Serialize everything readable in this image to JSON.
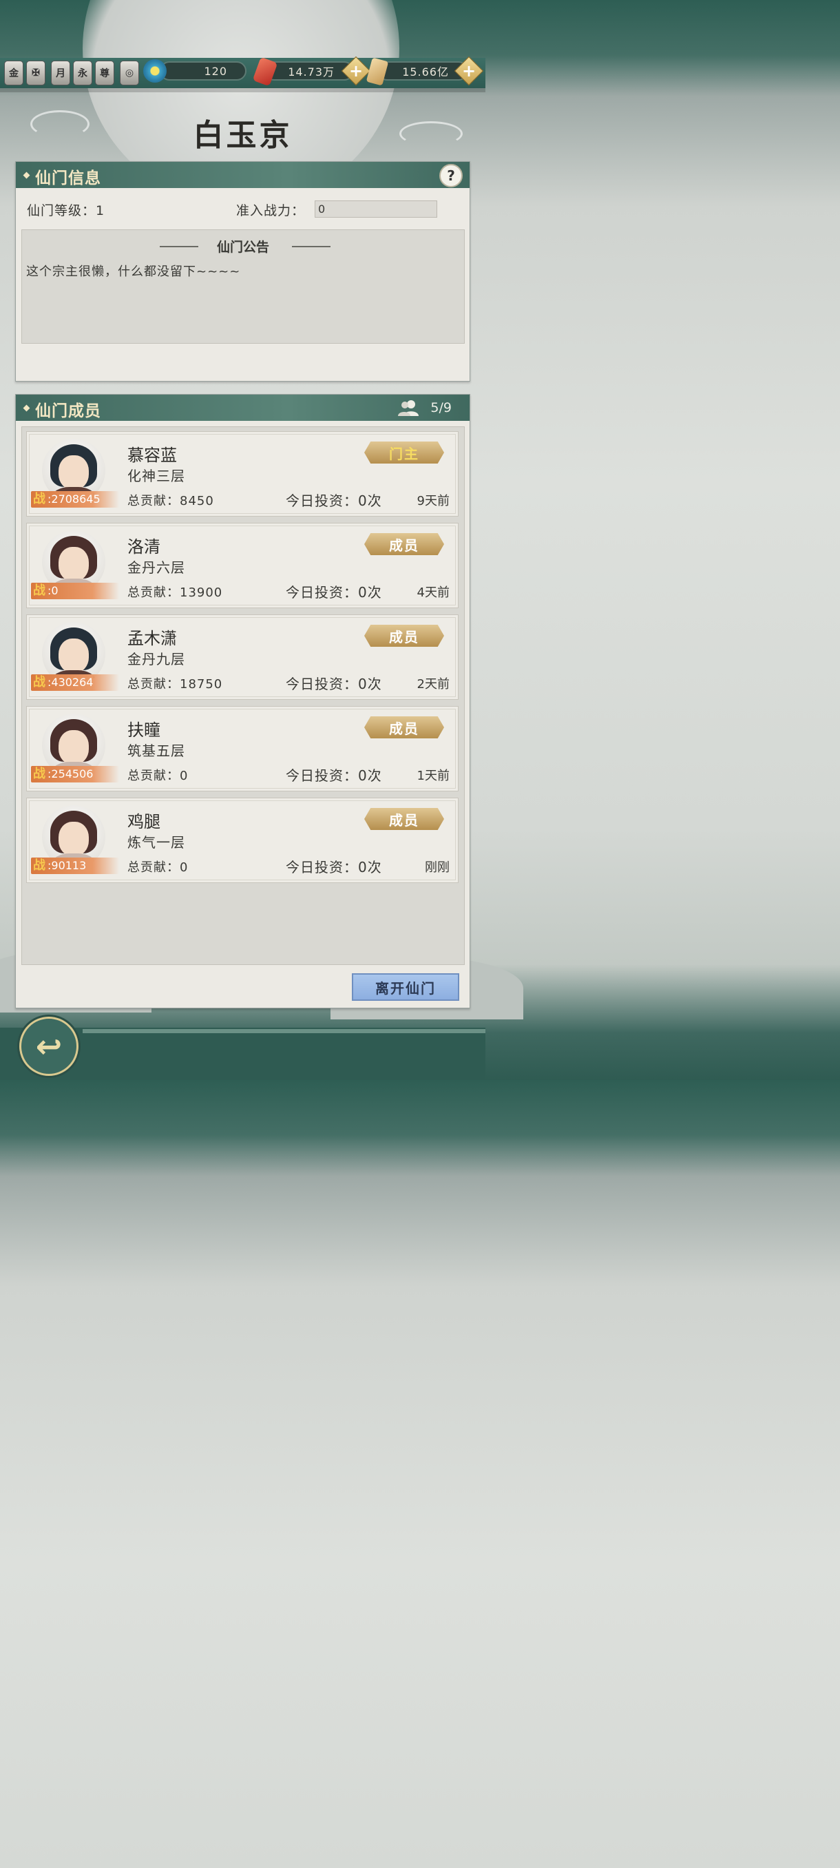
{
  "topbar": {
    "badges": [
      "金",
      "",
      "月",
      "永",
      "尊",
      ""
    ],
    "energy": "120",
    "currency1": "14.73万",
    "currency2": "15.66亿"
  },
  "title": "白玉京",
  "info_panel": {
    "header": "仙门信息",
    "help": "?",
    "level_label": "仙门等级：1",
    "power_label": "准入战力：",
    "power_value": "0",
    "notice_title": "仙门公告",
    "notice_text": "这个宗主很懒，什么都没留下~~~~"
  },
  "members_panel": {
    "header": "仙门成员",
    "count": "5/9",
    "members": [
      {
        "name": "慕容蓝",
        "rank": "化神三层",
        "power": ":2708645",
        "contribution": "总贡献：8450",
        "invest": "今日投资：0次",
        "time": "9天前",
        "role": "门主"
      },
      {
        "name": "洛清",
        "rank": "金丹六层",
        "power": ":0",
        "contribution": "总贡献：13900",
        "invest": "今日投资：0次",
        "time": "4天前",
        "role": "成员"
      },
      {
        "name": "孟木潇",
        "rank": "金丹九层",
        "power": ":430264",
        "contribution": "总贡献：18750",
        "invest": "今日投资：0次",
        "time": "2天前",
        "role": "成员"
      },
      {
        "name": "扶瞳",
        "rank": "筑基五层",
        "power": ":254506",
        "contribution": "总贡献：0",
        "invest": "今日投资：0次",
        "time": "1天前",
        "role": "成员"
      },
      {
        "name": "鸡腿",
        "rank": "炼气一层",
        "power": ":90113",
        "contribution": "总贡献：0",
        "invest": "今日投资：0次",
        "time": "刚刚",
        "role": "成员"
      }
    ],
    "power_prefix": "战",
    "leave_button": "离开仙门"
  },
  "back_icon": "back-arrow-icon",
  "colors": {
    "panel_header": "#4a7469",
    "accent_gold": "#c9a24f",
    "leave_button": "#9bbbe6"
  }
}
